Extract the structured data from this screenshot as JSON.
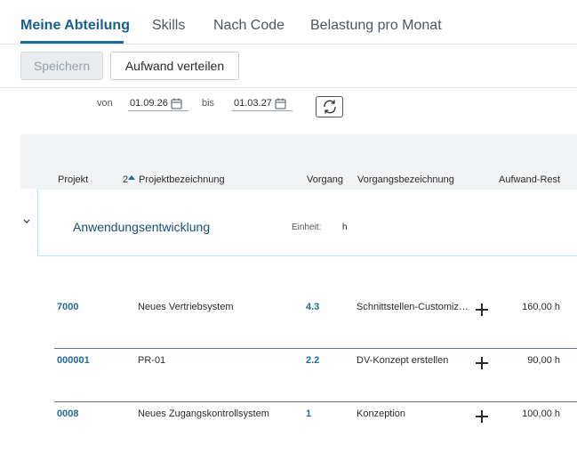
{
  "tabs": [
    {
      "label": "Meine Abteilung",
      "active": true
    },
    {
      "label": "Skills"
    },
    {
      "label": "Nach Code"
    },
    {
      "label": "Belastung pro Monat"
    }
  ],
  "toolbar": {
    "save_label": "Speichern",
    "distribute_label": "Aufwand verteilen"
  },
  "filter": {
    "from_label": "von",
    "from_value": "01.09.26",
    "to_label": "bis",
    "to_value": "01.03.27"
  },
  "table": {
    "columns": [
      "Projekt",
      "Projektbezeichnung",
      "Vorgang",
      "Vorgangsbezeichnung",
      "Aufwand-Rest"
    ],
    "sort_index": "2",
    "group": {
      "name": "Anwendungsentwicklung",
      "unit_label": "Einheit:",
      "unit_value": "h"
    },
    "rows": [
      {
        "project": "7000",
        "project_name": "Neues Vertriebsystem",
        "task": "4.3",
        "task_name": "Schnittstellen-Customizi…",
        "effort": "160,00 h"
      },
      {
        "project": "000001",
        "project_name": "PR-01",
        "task": "2.2",
        "task_name": "DV-Konzept erstellen",
        "effort": "90,00 h"
      },
      {
        "project": "0008",
        "project_name": "Neues Zugangskontrollsystem",
        "task": "1",
        "task_name": "Konzeption",
        "effort": "100,00 h"
      }
    ]
  },
  "colors": {
    "accent": "#1a6d99",
    "group_border": "#bfe3e6",
    "header_bg": "#f2f3f5"
  }
}
